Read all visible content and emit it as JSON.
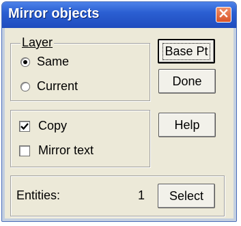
{
  "window": {
    "title": "Mirror objects"
  },
  "layer": {
    "label": "Layer",
    "options": [
      {
        "label": "Same",
        "selected": true
      },
      {
        "label": "Current",
        "selected": false
      }
    ]
  },
  "options": {
    "copy": {
      "label": "Copy",
      "checked": true
    },
    "mirror_text": {
      "label": "Mirror text",
      "checked": false
    }
  },
  "buttons": {
    "base_pt": "Base Pt",
    "done": "Done",
    "help": "Help",
    "select": "Select"
  },
  "entities": {
    "label": "Entities:",
    "count": "1"
  },
  "icons": {
    "close": "close-icon"
  },
  "colors": {
    "titlebar": "#2b5fd2",
    "close": "#d85428",
    "dialog_bg": "#ece9d8"
  }
}
